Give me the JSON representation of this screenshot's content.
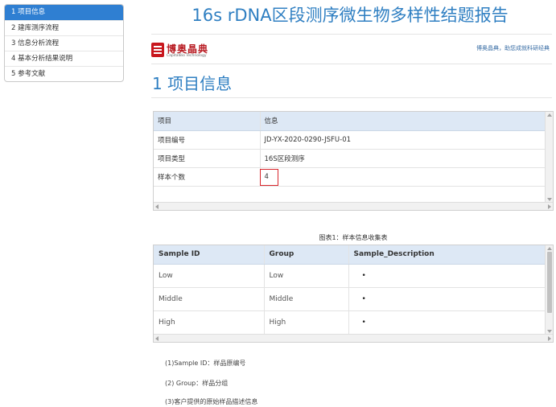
{
  "nav": {
    "items": [
      {
        "label": "1 项目信息",
        "active": true
      },
      {
        "label": "2 建库测序流程",
        "active": false
      },
      {
        "label": "3 信息分析流程",
        "active": false
      },
      {
        "label": "4 基本分析结果说明",
        "active": false
      },
      {
        "label": "5 参考文献",
        "active": false
      }
    ]
  },
  "header": {
    "title": "16s rDNA区段测序微生物多样性结题报告",
    "logo_cn": "博奥晶典",
    "logo_en": "CapitalBio Technology",
    "slogan": "博奥晶典，助您成就科研经典"
  },
  "section": {
    "title": "1 项目信息"
  },
  "project_table": {
    "headers": [
      "项目",
      "信息"
    ],
    "rows": [
      [
        "项目编号",
        "JD-YX-2020-0290-JSFU-01"
      ],
      [
        "项目类型",
        "16S区段测序"
      ],
      [
        "样本个数",
        "4"
      ]
    ]
  },
  "sample_table": {
    "caption": "图表1：样本信息收集表",
    "headers": [
      "Sample ID",
      "Group",
      "Sample_Description"
    ],
    "rows": [
      [
        "Low",
        "Low",
        "•"
      ],
      [
        "Middle",
        "Middle",
        "•"
      ],
      [
        "High",
        "High",
        "•"
      ]
    ]
  },
  "notes": [
    "(1)Sample ID：样品原编号",
    "(2) Group：样品分组",
    "(3)客户提供的原始样品描述信息"
  ],
  "colors": {
    "accent": "#2f7fc2",
    "nav_active": "#2f7fd2",
    "table_header": "#dde8f5",
    "highlight": "#d9262c",
    "logo_red": "#b81b22"
  }
}
